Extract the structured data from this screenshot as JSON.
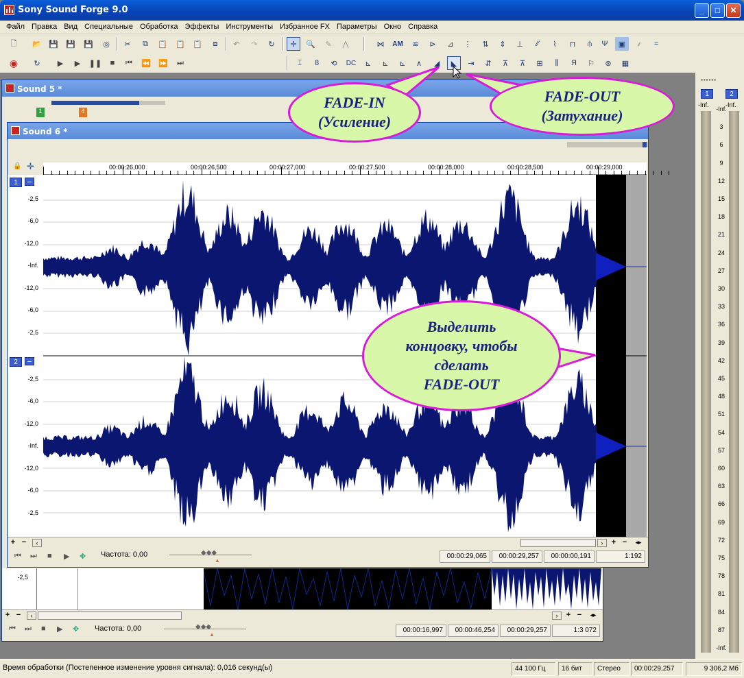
{
  "app": {
    "title": "Sony Sound Forge 9.0"
  },
  "menu": [
    "Файл",
    "Правка",
    "Вид",
    "Специальные",
    "Обработка",
    "Эффекты",
    "Инструменты",
    "Избранное FX",
    "Параметры",
    "Окно",
    "Справка"
  ],
  "toolbar2_labels": {
    "am": "AM",
    "dc": "DC"
  },
  "sound5": {
    "title": "Sound 5 *",
    "markers": [
      "1",
      "4"
    ],
    "db_label": "-2,5",
    "transport": {
      "rate": "Частота: 0,00"
    },
    "status": [
      "00:00:16,997",
      "00:00:46,254",
      "00:00:29,257",
      "1:3 072"
    ]
  },
  "sound6": {
    "title": "Sound 6 *",
    "ruler": [
      "00:00:26,000",
      "00:00:26,500",
      "00:00:27,000",
      "00:00:27,500",
      "00:00:28,000",
      "00:00:28,500",
      "00:00:29,000"
    ],
    "channels": [
      "1",
      "2"
    ],
    "db_scale": [
      "-2,5",
      "-6,0",
      "-12,0",
      "-Inf.",
      "-12,0",
      "-6,0",
      "-2,5"
    ],
    "transport": {
      "rate": "Частота: 0,00"
    },
    "status": [
      "00:00:29,065",
      "00:00:29,257",
      "00:00:00,191",
      "1:192"
    ]
  },
  "meters": {
    "channels": [
      "1",
      "2"
    ],
    "labels": [
      "-Inf.",
      "3",
      "6",
      "9",
      "12",
      "15",
      "18",
      "21",
      "24",
      "27",
      "30",
      "33",
      "36",
      "39",
      "42",
      "45",
      "48",
      "51",
      "54",
      "57",
      "60",
      "63",
      "66",
      "69",
      "72",
      "75",
      "78",
      "81",
      "84",
      "87",
      "-Inf."
    ],
    "top_labels": [
      "-Inf.",
      "-Inf."
    ]
  },
  "statusbar": {
    "message": "Время обработки (Постепенное изменение уровня сигнала): 0,016 секунд(ы)",
    "sample_rate": "44 100 Гц",
    "bits": "16 бит",
    "channels": "Стерео",
    "length": "00:00:29,257",
    "free": "9 306,2 Мб"
  },
  "callouts": {
    "fade_in": [
      "FADE-IN",
      "(Усиление)"
    ],
    "fade_out": [
      "FADE-OUT",
      "(Затухание)"
    ],
    "select": [
      "Выделить",
      "концовку, чтобы",
      "сделать",
      "FADE-OUT"
    ]
  },
  "colors": {
    "waveform": "#0a1670",
    "callout_fill": "#d8f7a8",
    "callout_border": "#d81bd8",
    "callout_text": "#1a2280"
  }
}
